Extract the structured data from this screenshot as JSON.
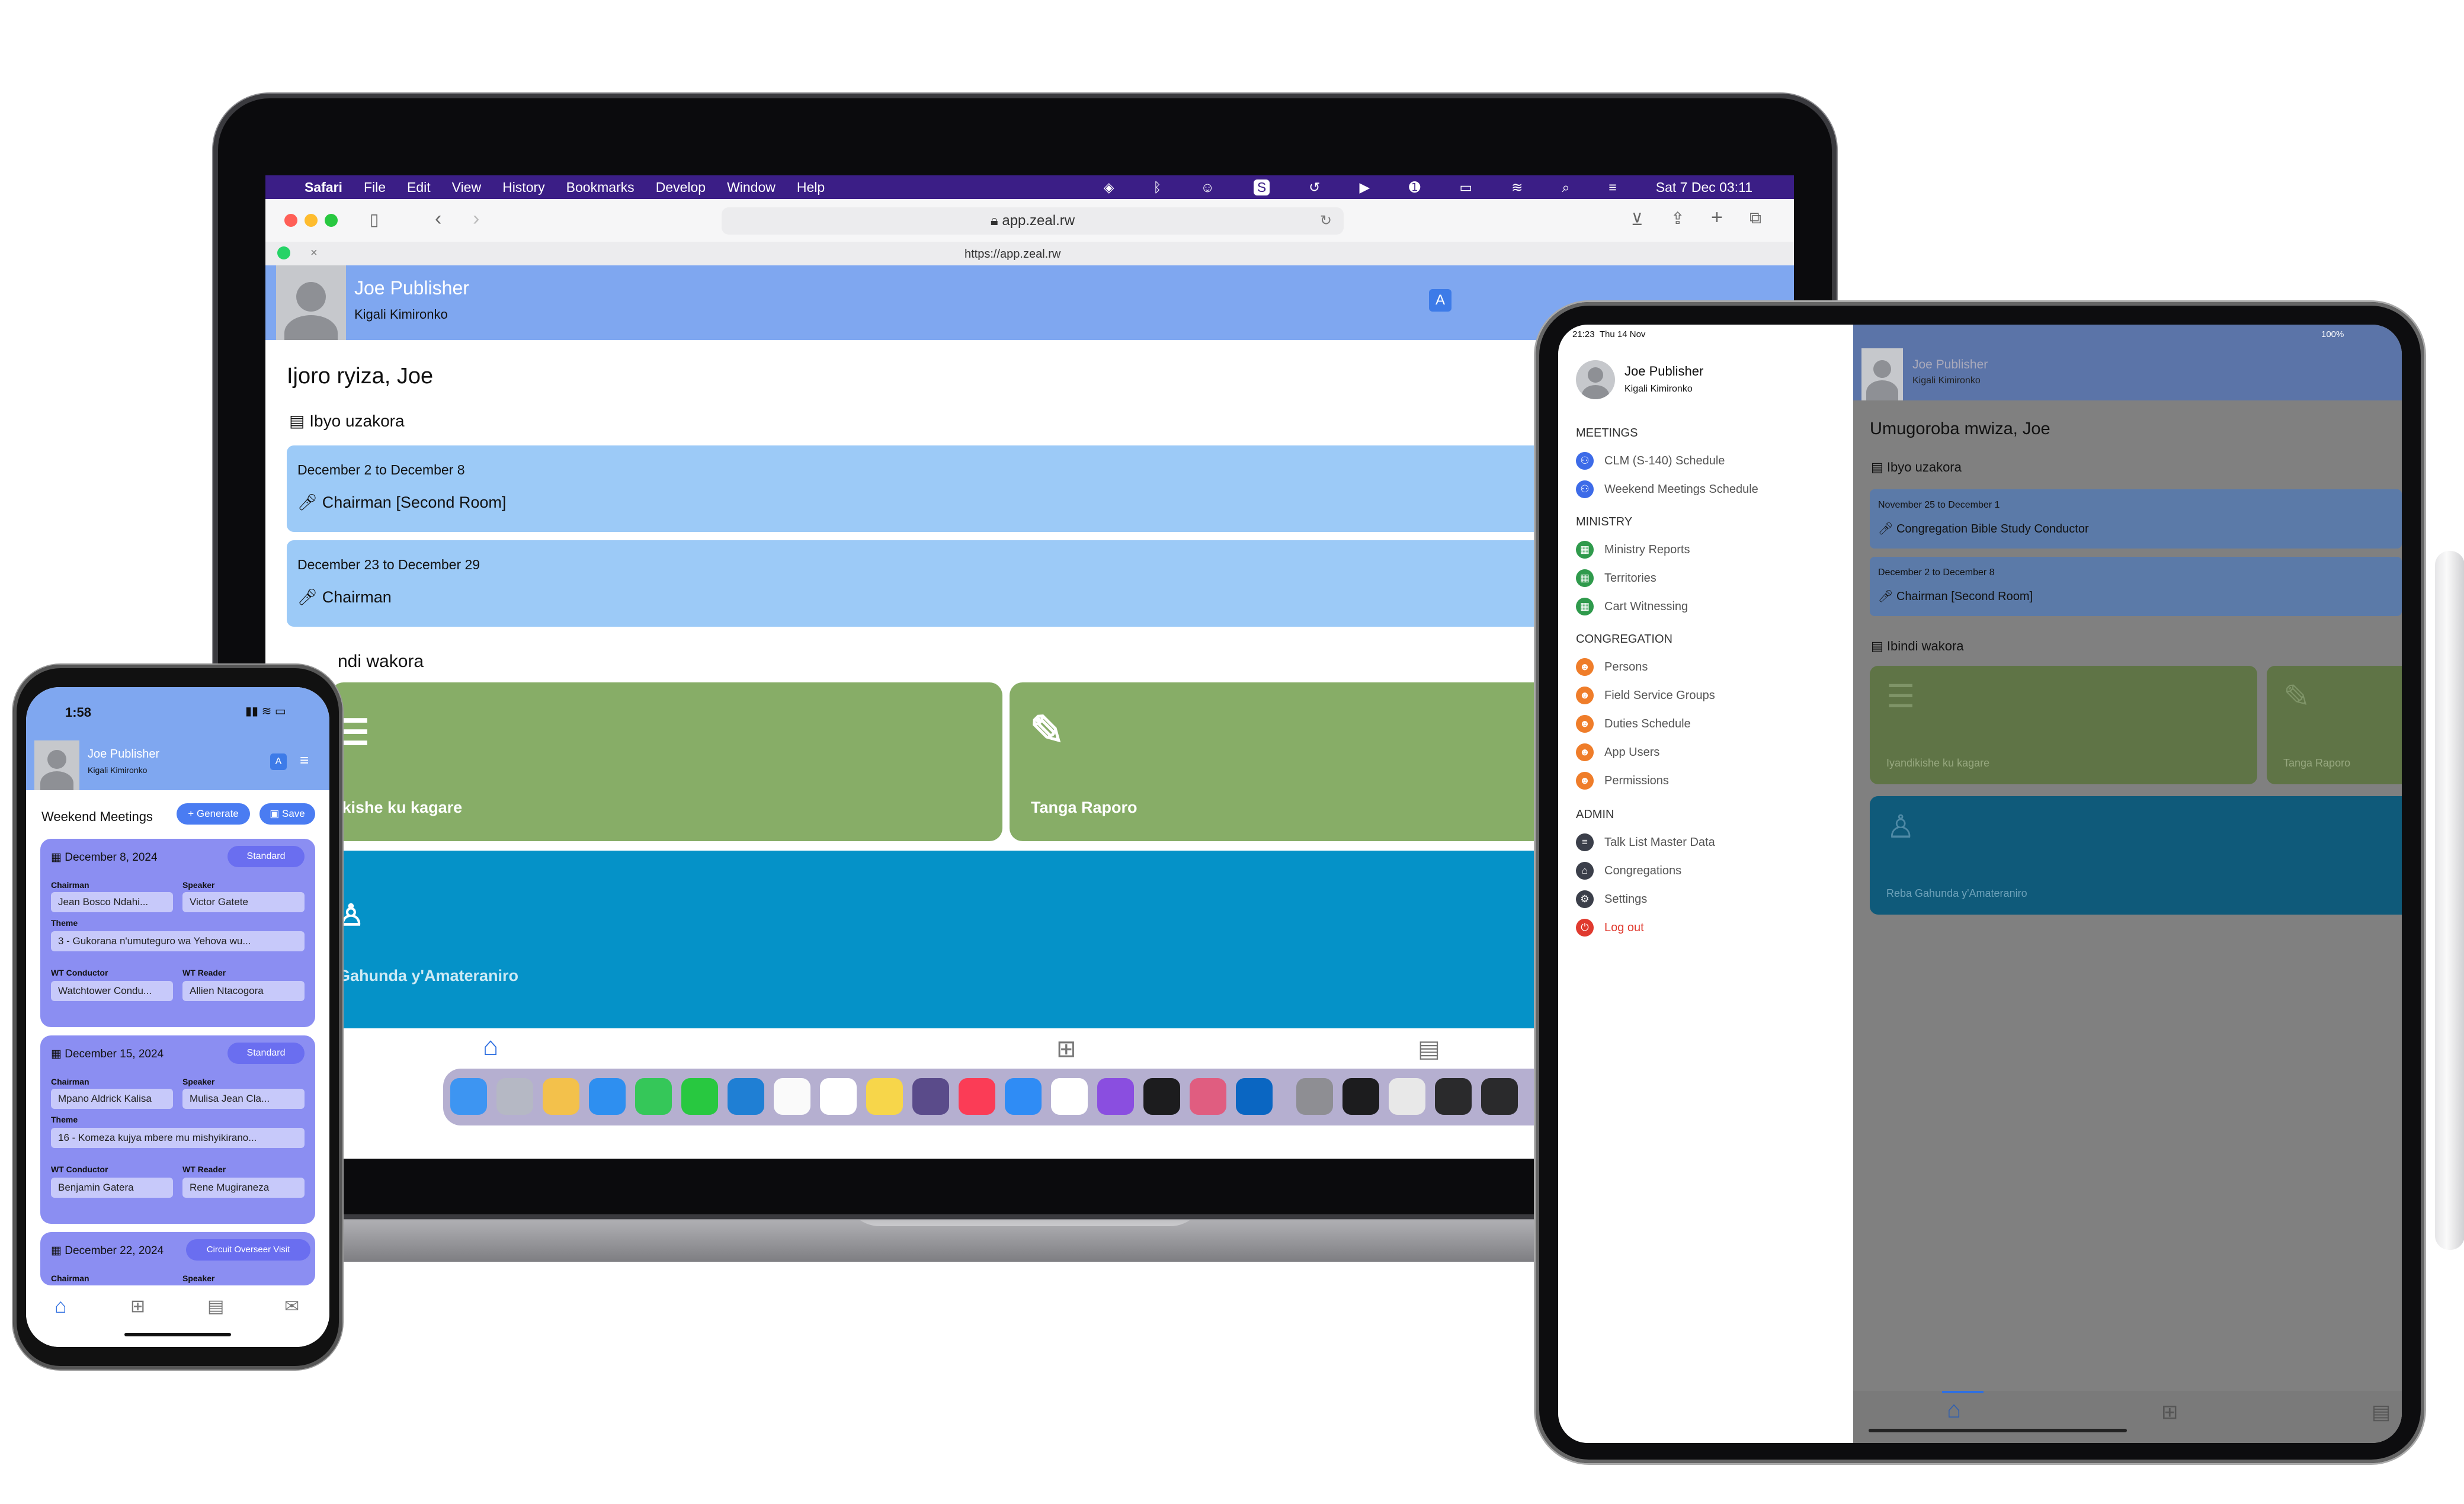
{
  "laptop": {
    "menubar": {
      "items": [
        "Safari",
        "File",
        "Edit",
        "View",
        "History",
        "Bookmarks",
        "Develop",
        "Window",
        "Help"
      ],
      "datetime": "Sat 7 Dec  03:11"
    },
    "browser": {
      "url": "app.zeal.rw",
      "tab_url": "https://app.zeal.rw"
    },
    "header": {
      "name": "Joe Publisher",
      "congregation": "Kigali Kimironko"
    },
    "greeting": "Ijoro ryiza, Joe",
    "assignments_title": "Ibyo uzakora",
    "assignments": [
      {
        "dates": "December 2 to December 8",
        "role": "Chairman [Second Room]"
      },
      {
        "dates": "December 23 to December 29",
        "role": "Chairman"
      }
    ],
    "other_title": "ndi wakora",
    "tiles": [
      {
        "label": "ikishe ku kagare",
        "color": "#87ad67"
      },
      {
        "label": "Tanga Raporo",
        "color": "#87ad67"
      },
      {
        "label": "Gahunda y'Amateraniro",
        "color": "#0592c8"
      }
    ]
  },
  "phone": {
    "time": "1:58",
    "header": {
      "name": "Joe Publisher",
      "congregation": "Kigali Kimironko"
    },
    "page_title": "Weekend Meetings",
    "generate_label": "+ Generate",
    "save_label": "Save",
    "meetings": [
      {
        "date": "December 8, 2024",
        "badge": "Standard",
        "chairman": "Jean Bosco Ndahi...",
        "speaker": "Victor Gatete",
        "theme": "3 - Gukorana n'umuteguro wa Yehova wu...",
        "wt_conductor": "Watchtower Condu...",
        "wt_reader": "Allien Ntacogora"
      },
      {
        "date": "December 15, 2024",
        "badge": "Standard",
        "chairman": "Mpano Aldrick Kalisa",
        "speaker": "Mulisa Jean Cla...",
        "theme": "16 - Komeza kujya mbere mu mishyikirano...",
        "wt_conductor": "Benjamin Gatera",
        "wt_reader": "Rene  Mugiraneza"
      },
      {
        "date": "December 22, 2024",
        "badge": "Circuit Overseer Visit",
        "chairman": "",
        "speaker": "",
        "theme": "",
        "wt_conductor": "",
        "wt_reader": ""
      }
    ],
    "labels": {
      "chairman": "Chairman",
      "speaker": "Speaker",
      "theme": "Theme",
      "wt_conductor": "WT Conductor",
      "wt_reader": "WT Reader"
    }
  },
  "tablet": {
    "status": {
      "time": "21:23",
      "date": "Thu 14 Nov",
      "battery": "100%"
    },
    "drawer": {
      "name": "Joe Publisher",
      "congregation": "Kigali Kimironko",
      "sections": [
        {
          "title": "MEETINGS",
          "items": [
            {
              "label": "CLM (S-140) Schedule",
              "color": "#3d6be8"
            },
            {
              "label": "Weekend Meetings Schedule",
              "color": "#3d6be8"
            }
          ]
        },
        {
          "title": "MINISTRY",
          "items": [
            {
              "label": "Ministry Reports",
              "color": "#2f9a4c"
            },
            {
              "label": "Territories",
              "color": "#2f9a4c"
            },
            {
              "label": "Cart Witnessing",
              "color": "#2f9a4c"
            }
          ]
        },
        {
          "title": "CONGREGATION",
          "items": [
            {
              "label": "Persons",
              "color": "#ef7d2a"
            },
            {
              "label": "Field Service Groups",
              "color": "#ef7d2a"
            },
            {
              "label": "Duties Schedule",
              "color": "#ef7d2a"
            },
            {
              "label": "App Users",
              "color": "#ef7d2a"
            },
            {
              "label": "Permissions",
              "color": "#ef7d2a"
            }
          ]
        },
        {
          "title": "ADMIN",
          "items": [
            {
              "label": "Talk List Master Data",
              "color": "#3b3f4a"
            },
            {
              "label": "Congregations",
              "color": "#3b3f4a"
            },
            {
              "label": "Settings",
              "color": "#3b3f4a"
            },
            {
              "label": "Log out",
              "color": "#e03a2f"
            }
          ]
        }
      ]
    },
    "header": {
      "name": "Joe Publisher",
      "congregation": "Kigali Kimironko"
    },
    "greeting": "Umugoroba mwiza, Joe",
    "assignments_title": "Ibyo uzakora",
    "assignments": [
      {
        "dates": "November 25 to December 1",
        "role": "Congregation Bible Study Conductor"
      },
      {
        "dates": "December 2 to December 8",
        "role": "Chairman [Second Room]"
      }
    ],
    "other_title": "Ibindi wakora",
    "tiles": [
      {
        "label": "Iyandikishe ku kagare"
      },
      {
        "label": "Tanga Raporo"
      },
      {
        "label": "Reba Gahunda y'Amateraniro"
      }
    ]
  }
}
